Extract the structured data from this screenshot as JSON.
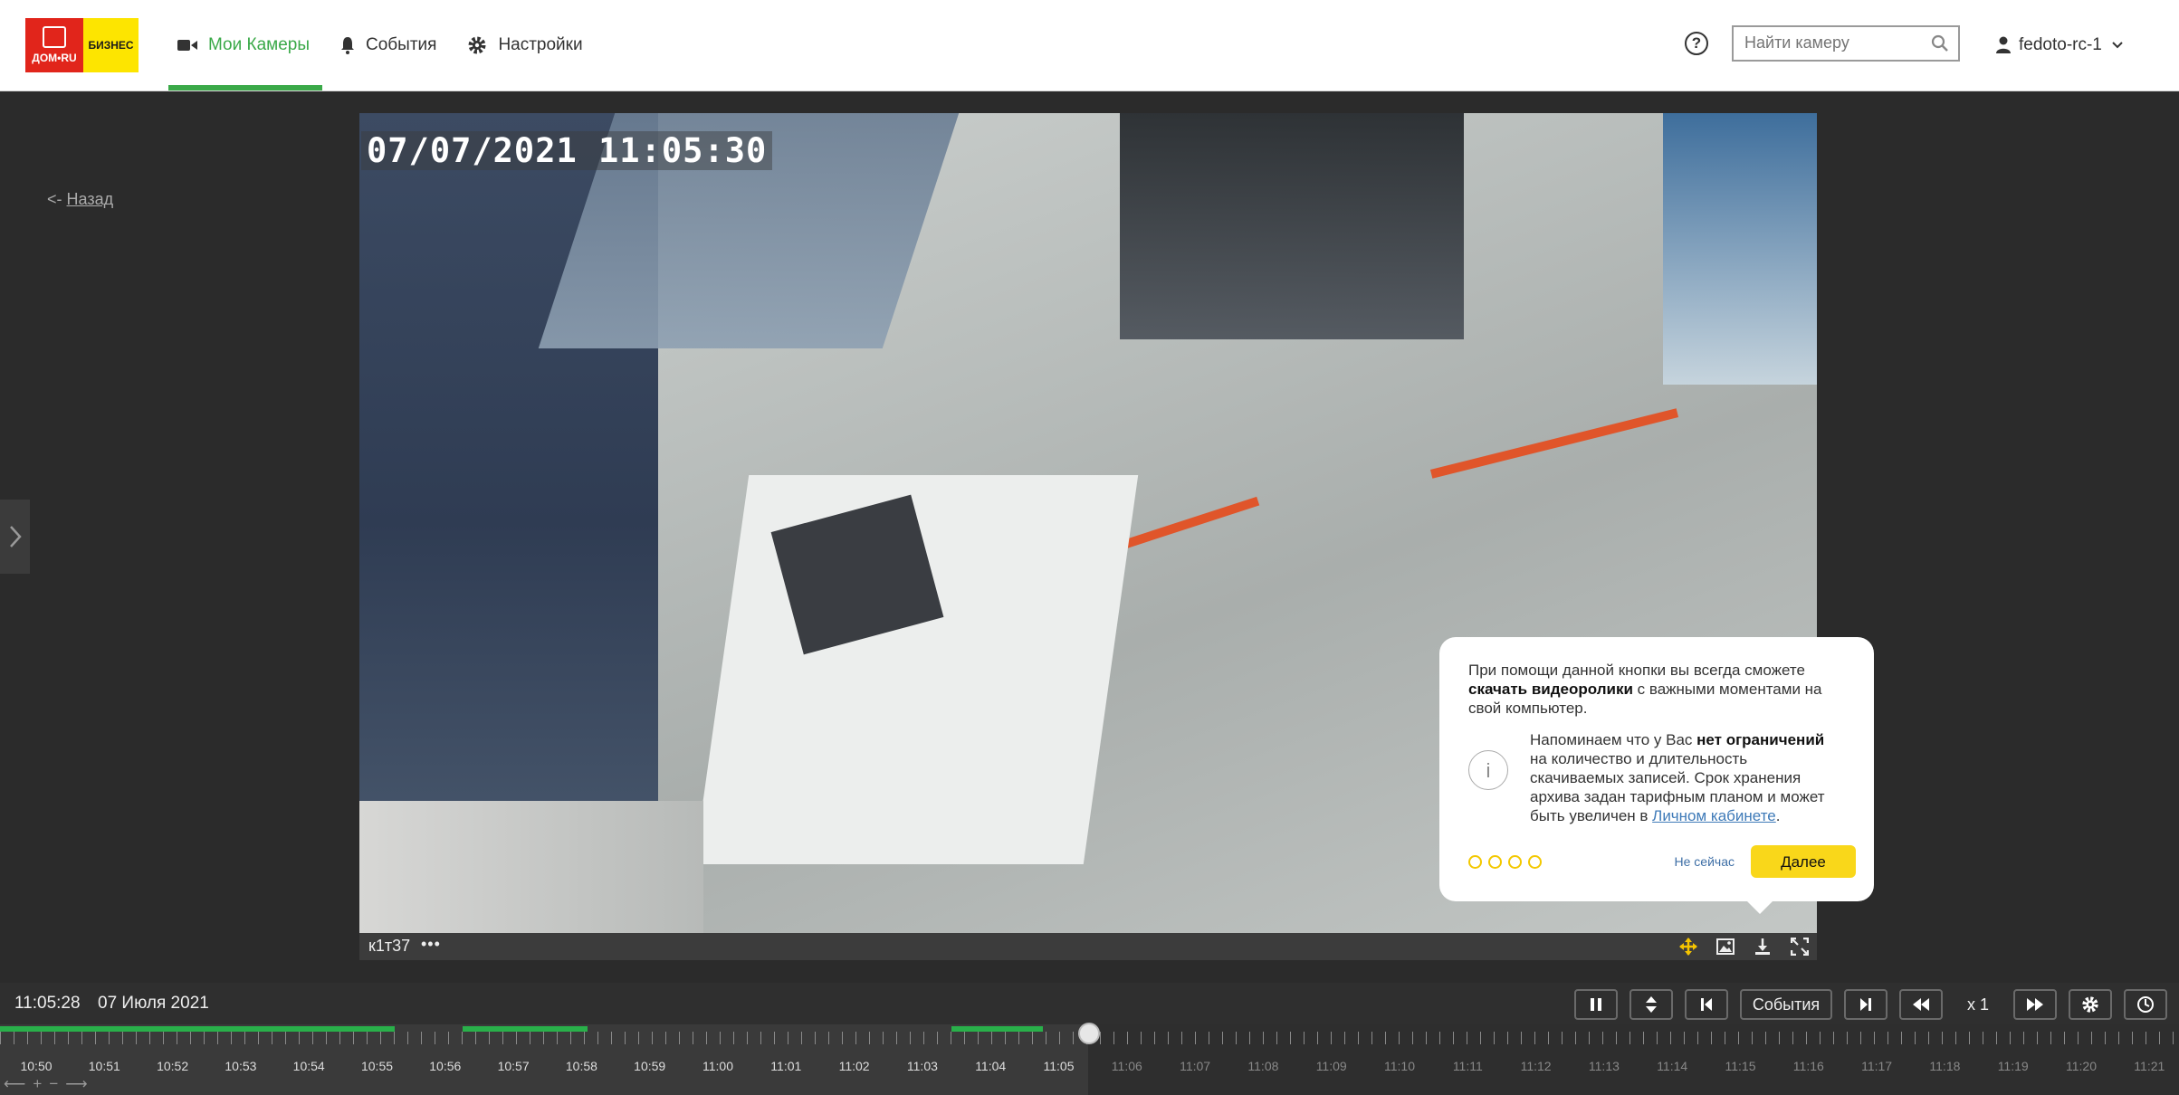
{
  "header": {
    "logo_top": "ДОМ•RU",
    "logo_bottom": "БИЗНЕС",
    "nav": [
      {
        "label": "Мои Камеры",
        "icon": "video-camera-icon",
        "active": true
      },
      {
        "label": "События",
        "icon": "bell-icon",
        "active": false
      },
      {
        "label": "Настройки",
        "icon": "gear-icon",
        "active": false
      }
    ],
    "help_label": "?",
    "search": {
      "placeholder": "Найти камеру",
      "value": ""
    },
    "user": "fedoto-rc-1"
  },
  "back": {
    "prefix": "<-",
    "label": "Назад"
  },
  "video": {
    "osd_timestamp": "07/07/2021 11:05:30",
    "camera_name": "к1т37",
    "more": "•••"
  },
  "tooltip": {
    "p1_start": "При помощи данной кнопки вы всегда сможете ",
    "p1_bold": "скачать видеоролики",
    "p1_end": " с важными моментами на свой компьютер.",
    "p2_start": "Напоминаем что у Вас ",
    "p2_bold": "нет ограничений",
    "p2_mid": " на количество и длительность скачиваемых записей. Срок хранения архива задан тарифным планом и может быть увеличен в ",
    "p2_link": "Личном кабинете",
    "p2_end": ".",
    "info_icon": "i",
    "later_label": "Не сейчас",
    "next_label": "Далее",
    "steps": 4
  },
  "player": {
    "time": "11:05:28",
    "date": "07 Июля 2021",
    "events_label": "События",
    "speed": "x 1"
  },
  "timeline": {
    "labels": [
      "10:50",
      "10:51",
      "10:52",
      "10:53",
      "10:54",
      "10:55",
      "10:56",
      "10:57",
      "10:58",
      "10:59",
      "11:00",
      "11:01",
      "11:02",
      "11:03",
      "11:04",
      "11:05",
      "11:06",
      "11:07",
      "11:08",
      "11:09",
      "11:10",
      "11:11",
      "11:12",
      "11:13",
      "11:14",
      "11:15",
      "11:16",
      "11:17",
      "11:18",
      "11:19",
      "11:20",
      "11:21"
    ],
    "current_label_index": 15
  },
  "colors": {
    "accent_green": "#3aa948",
    "brand_red": "#e1251b",
    "brand_yellow": "#fde500",
    "button_yellow": "#f9d71a",
    "record_green": "#29b04a"
  }
}
